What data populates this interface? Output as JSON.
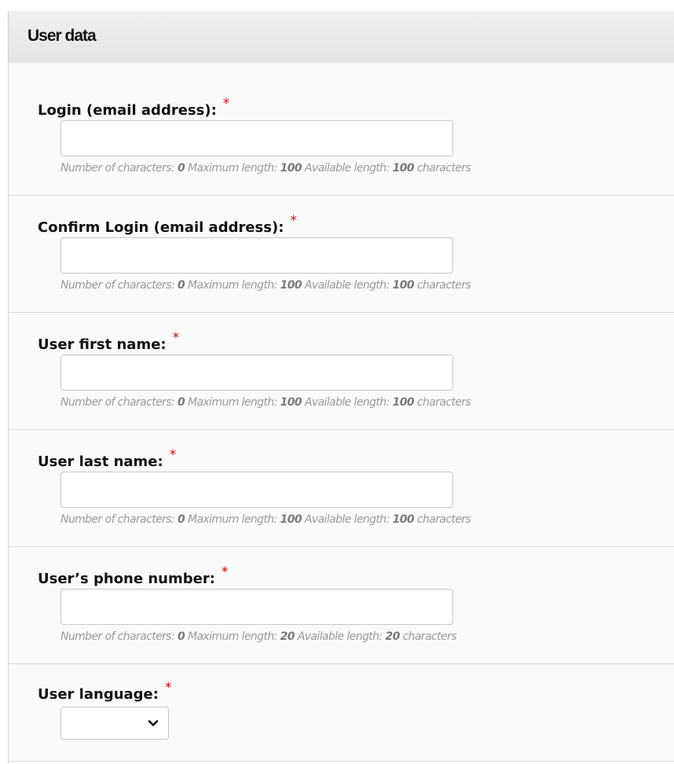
{
  "panel": {
    "title": "User data"
  },
  "fields": [
    {
      "label": "Login (email address):",
      "required": "*",
      "value": "",
      "counter": {
        "count_label": "Number of characters:",
        "count": "0",
        "max_label": "Maximum length:",
        "max": "100",
        "avail_label": "Available length:",
        "avail": "100",
        "unit": "characters"
      }
    },
    {
      "label": "Confirm Login (email address):",
      "required": "*",
      "value": "",
      "counter": {
        "count_label": "Number of characters:",
        "count": "0",
        "max_label": "Maximum length:",
        "max": "100",
        "avail_label": "Available length:",
        "avail": "100",
        "unit": "characters"
      }
    },
    {
      "label": "User first name:",
      "required": "*",
      "value": "",
      "counter": {
        "count_label": "Number of characters:",
        "count": "0",
        "max_label": "Maximum length:",
        "max": "100",
        "avail_label": "Available length:",
        "avail": "100",
        "unit": "characters"
      }
    },
    {
      "label": "User last name:",
      "required": "*",
      "value": "",
      "counter": {
        "count_label": "Number of characters:",
        "count": "0",
        "max_label": "Maximum length:",
        "max": "100",
        "avail_label": "Available length:",
        "avail": "100",
        "unit": "characters"
      }
    },
    {
      "label": "User’s phone number:",
      "required": "*",
      "value": "",
      "counter": {
        "count_label": "Number of characters:",
        "count": "0",
        "max_label": "Maximum length:",
        "max": "20",
        "avail_label": "Available length:",
        "avail": "20",
        "unit": "characters"
      }
    }
  ],
  "language": {
    "label": "User language:",
    "required": "*",
    "selected": "",
    "icon": "chevron-down-icon"
  },
  "colors": {
    "required": "#e00000",
    "hint": "#9a9a9a",
    "border": "#c8c8c8"
  }
}
